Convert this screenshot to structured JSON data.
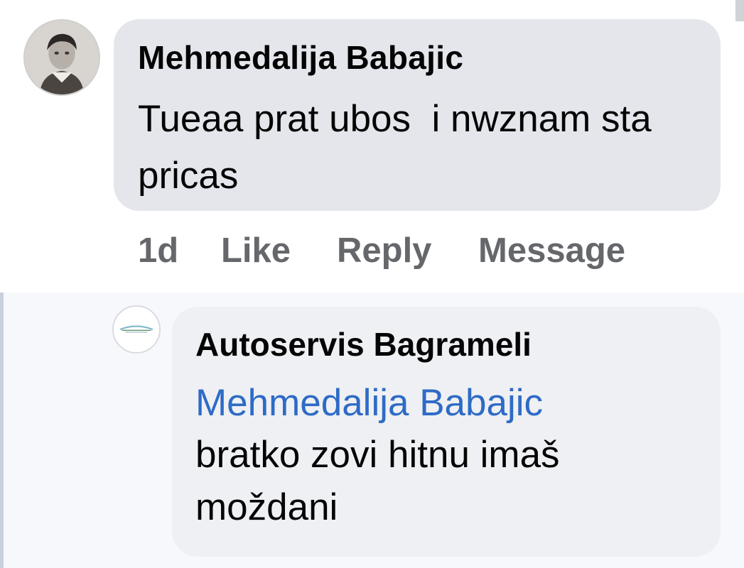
{
  "comment": {
    "author": "Mehmedalija Babajic",
    "text": "Tueaa prat ubos  i nwznam sta pricas",
    "avatar_icon": "user-photo-avatar",
    "actions": {
      "time": "1d",
      "like": "Like",
      "reply": "Reply",
      "message": "Message"
    }
  },
  "reply": {
    "author": "Autoservis Bagrameli",
    "mention": "Mehmedalija Babajic",
    "text": "bratko zovi hitnu imaš moždani",
    "avatar_icon": "business-logo-avatar"
  },
  "colors": {
    "comment_bubble": "#e4e6eb",
    "reply_bubble": "#eff0f3",
    "mention": "#2e6bc6",
    "action_text": "#65676b"
  }
}
